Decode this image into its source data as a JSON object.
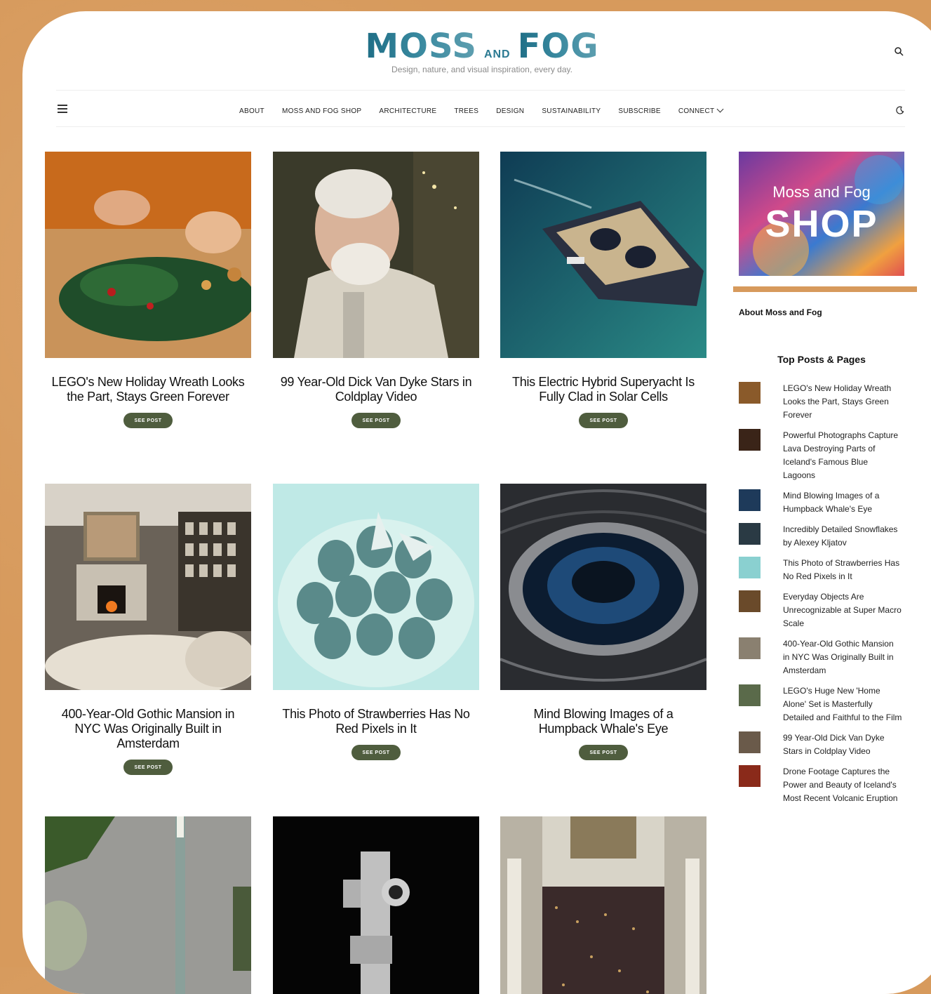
{
  "site": {
    "logo_main_1": "MOSS",
    "logo_and": "AND",
    "logo_main_2": "FOG",
    "tagline": "Design, nature, and visual inspiration, every day."
  },
  "nav": {
    "items": [
      "ABOUT",
      "MOSS AND FOG SHOP",
      "ARCHITECTURE",
      "TREES",
      "DESIGN",
      "SUSTAINABILITY",
      "SUBSCRIBE",
      "CONNECT"
    ]
  },
  "posts": [
    {
      "title": "LEGO's New Holiday Wreath Looks the Part, Stays Green Forever",
      "button": "SEE POST"
    },
    {
      "title": "99 Year-Old Dick Van Dyke Stars in Coldplay Video",
      "button": "SEE POST"
    },
    {
      "title": "This Electric Hybrid Superyacht Is Fully Clad in Solar Cells",
      "button": "SEE POST"
    },
    {
      "title": "400-Year-Old Gothic Mansion in NYC Was Originally Built in Amsterdam",
      "button": "SEE POST"
    },
    {
      "title": "This Photo of Strawberries Has No Red Pixels in It",
      "button": "SEE POST"
    },
    {
      "title": "Mind Blowing Images of a Humpback Whale's Eye",
      "button": "SEE POST"
    }
  ],
  "sidebar": {
    "shop_line1": "Moss and Fog",
    "shop_line2": "SHOP",
    "about_heading": "About Moss and Fog",
    "top_heading": "Top Posts & Pages",
    "top_posts": [
      "LEGO's New Holiday Wreath Looks the Part, Stays Green Forever",
      "Powerful Photographs Capture Lava Destroying Parts of Iceland's Famous Blue Lagoons",
      "Mind Blowing Images of a Humpback Whale's Eye",
      "Incredibly Detailed Snowflakes by Alexey Kljatov",
      "This Photo of Strawberries Has No Red Pixels in It",
      "Everyday Objects Are Unrecognizable at Super Macro Scale",
      "400-Year-Old Gothic Mansion in NYC Was Originally Built in Amsterdam",
      "LEGO's Huge New 'Home Alone' Set is Masterfully Detailed and Faithful to the Film",
      "99 Year-Old Dick Van Dyke Stars in Coldplay Video",
      "Drone Footage Captures the Power and Beauty of Iceland's Most Recent Volcanic Eruption"
    ]
  },
  "colors": {
    "accent": "#4f5d3e",
    "background": "#d79a5c",
    "logo": "#1f6e86"
  }
}
